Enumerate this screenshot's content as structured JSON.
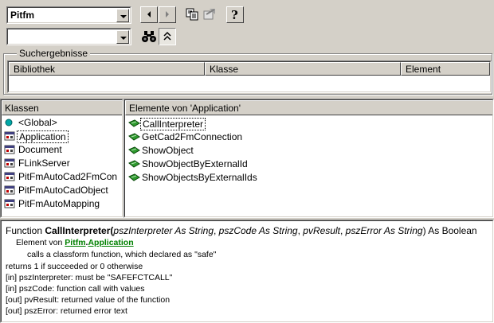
{
  "toolbar": {
    "library_combo": "Pitfm",
    "search_combo": "",
    "buttons": [
      {
        "name": "back-button",
        "icon": "arrow-left-icon"
      },
      {
        "name": "forward-button",
        "icon": "arrow-right-icon"
      },
      {
        "name": "copy-button",
        "icon": "copy-icon"
      },
      {
        "name": "view-definition-button",
        "icon": "view-definition-icon"
      },
      {
        "name": "help-button",
        "icon": "help-icon",
        "label": "?"
      },
      {
        "name": "search-button",
        "icon": "binoculars-icon"
      },
      {
        "name": "toggle-results-button",
        "icon": "collapse-icon"
      }
    ]
  },
  "search_results": {
    "title": "Suchergebnisse",
    "columns": [
      "Bibliothek",
      "Klasse",
      "Element"
    ]
  },
  "classes": {
    "header": "Klassen",
    "items": [
      {
        "label": "<Global>",
        "icon": "global-icon"
      },
      {
        "label": "Application",
        "icon": "class-icon",
        "selected": true
      },
      {
        "label": "Document",
        "icon": "class-icon"
      },
      {
        "label": "FLinkServer",
        "icon": "class-icon"
      },
      {
        "label": "PitFmAutoCad2FmCon",
        "icon": "class-icon"
      },
      {
        "label": "PitFmAutoCadObject",
        "icon": "class-icon"
      },
      {
        "label": "PitFmAutoMapping",
        "icon": "class-icon"
      }
    ]
  },
  "members": {
    "header": "Elemente von 'Application'",
    "items": [
      {
        "label": "CallInterpreter",
        "icon": "method-icon",
        "selected": true
      },
      {
        "label": "GetCad2FmConnection",
        "icon": "method-icon"
      },
      {
        "label": "ShowObject",
        "icon": "method-icon"
      },
      {
        "label": "ShowObjectByExternalId",
        "icon": "method-icon"
      },
      {
        "label": "ShowObjectsByExternalIds",
        "icon": "method-icon"
      }
    ]
  },
  "details": {
    "kw_function": "Function ",
    "name": "CallInterpreter",
    "open": "(",
    "p1": "pszInterpreter As String",
    "sep1": ", ",
    "p2": "pszCode As String",
    "sep2": ", ",
    "p3": "pvResult",
    "sep3": ", ",
    "p4": "pszError As String",
    "close": ") As Boolean",
    "member_of": "Element von ",
    "lib_link": "Pitfm",
    "dot": ".",
    "class_link": "Application",
    "desc": "calls a classform function, which declared as \"safe\"",
    "lines": [
      "returns 1 if succeeded or 0 otherwise",
      "[in] pszInterpreter: must be \"SAFEFCTCALL\"",
      "[in] pszCode: function call with values",
      "[out] pvResult: returned value of the function",
      "[out] pszError: returned error text"
    ]
  },
  "colors": {
    "link": "#008000",
    "method_icon": "#2e9b2e",
    "global_icon": "#00a8a8"
  }
}
